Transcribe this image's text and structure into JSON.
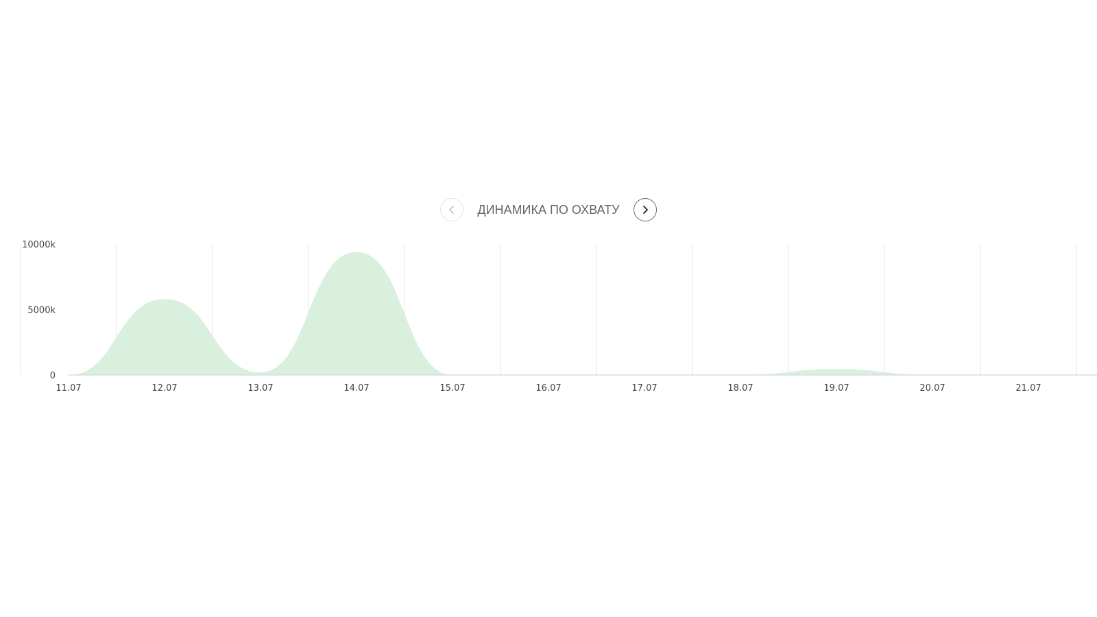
{
  "header": {
    "title": "ДИНАМИКА ПО ОХВАТУ",
    "prev_icon": "chevron-left-icon",
    "next_icon": "chevron-right-icon"
  },
  "colors": {
    "area_fill": "#d9f0df",
    "grid": "#e4e4e4",
    "axis": "#d5dde3",
    "text": "#444444"
  },
  "chart_data": {
    "type": "area",
    "title": "ДИНАМИКА ПО ОХВАТУ",
    "xlabel": "",
    "ylabel": "",
    "categories": [
      "11.07",
      "12.07",
      "13.07",
      "14.07",
      "15.07",
      "16.07",
      "17.07",
      "18.07",
      "19.07",
      "20.07",
      "21.07"
    ],
    "y_ticks": [
      "0",
      "5000k",
      "10000k"
    ],
    "ylim": [
      0,
      10000
    ],
    "y_unit": "k",
    "grid": true,
    "legend": "none",
    "series": [
      {
        "values": [
          0,
          5800,
          200,
          9400,
          0,
          0,
          0,
          0,
          450,
          0,
          0
        ]
      }
    ]
  }
}
